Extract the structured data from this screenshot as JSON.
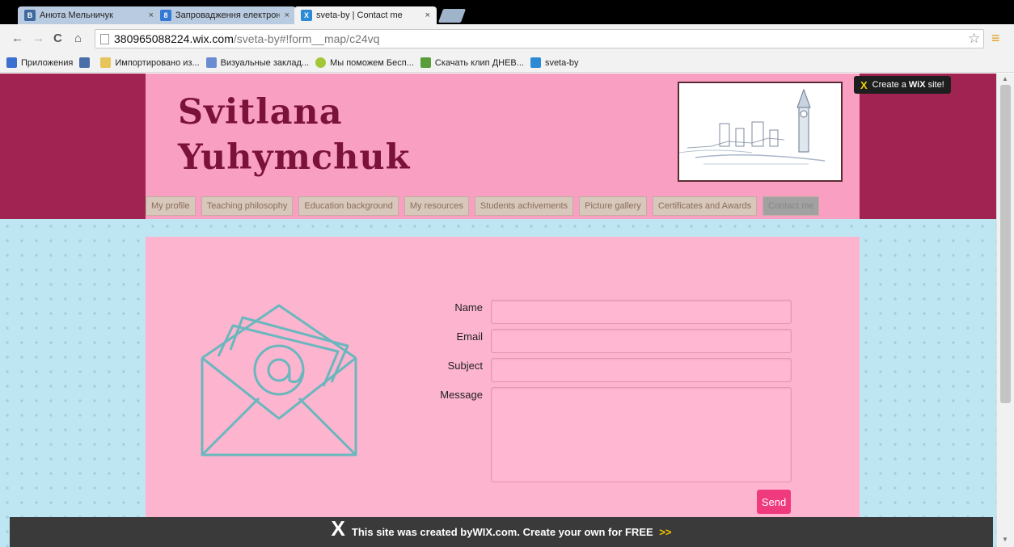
{
  "browser": {
    "tabs": [
      {
        "title": "Анюта Мельничук",
        "icon_text": "B",
        "icon_color": "#3f6aa0",
        "active": false
      },
      {
        "title": "Запровадження електрон",
        "icon_text": "8",
        "icon_color": "#3579d6",
        "active": false
      },
      {
        "title": "sveta-by | Contact me",
        "icon_text": "X",
        "icon_color": "#2a8ad6",
        "active": true
      }
    ],
    "close_glyph": "×",
    "url_host": "380965088224.wix.com",
    "url_path": "/sveta-by#!form__map/c24vq",
    "nav": {
      "back": "←",
      "forward": "→",
      "reload": "C",
      "home": "⌂"
    },
    "star_icon": "☆",
    "menu_icon": "≡",
    "bookmarks": [
      {
        "label": "Приложения",
        "icon": "apps-icon",
        "color": "#3b6fd0"
      },
      {
        "label": "",
        "icon": "vk-icon",
        "color": "#4a6ea8"
      },
      {
        "label": "Импортировано из...",
        "icon": "folder-icon",
        "color": "#e8c55a"
      },
      {
        "label": "Визуальные заклад...",
        "icon": "grid-icon",
        "color": "#6a8cd0"
      },
      {
        "label": "Мы поможем Бесп...",
        "icon": "android-icon",
        "color": "#a4c639"
      },
      {
        "label": "Скачать клип ДНЕВ...",
        "icon": "clip-icon",
        "color": "#5a9e3a"
      },
      {
        "label": "sveta-by",
        "icon": "wix-icon",
        "color": "#2a8ad6"
      }
    ]
  },
  "site": {
    "title_line1": "Svitlana",
    "title_line2": "Yuhymchuk",
    "create_wix": {
      "prefix": "Create a",
      "brand": "WiX",
      "suffix": "site!"
    },
    "nav": [
      {
        "label": "My profile",
        "active": false
      },
      {
        "label": "Teaching philosophy",
        "active": false
      },
      {
        "label": "Education background",
        "active": false
      },
      {
        "label": "My resources",
        "active": false
      },
      {
        "label": "Students achivements",
        "active": false
      },
      {
        "label": "Picture gallery",
        "active": false
      },
      {
        "label": "Certificates and Awards",
        "active": false
      },
      {
        "label": "Contact me",
        "active": true
      }
    ],
    "form": {
      "name_label": "Name",
      "email_label": "Email",
      "subject_label": "Subject",
      "message_label": "Message",
      "name_value": "",
      "email_value": "",
      "subject_value": "",
      "message_value": "",
      "send_label": "Send"
    },
    "footer": {
      "text_before": "This site was created by ",
      "brand": "WIX.com",
      "text_after": ". Create your own for FREE ",
      "arrows": ">>"
    },
    "colors": {
      "header_band": "#a12352",
      "header_inner": "#f99fc2",
      "content_bg": "#fdb4cf",
      "send_button": "#f03a7e",
      "envelope_stroke": "#6ab7be",
      "title_color": "#7a1239"
    }
  }
}
